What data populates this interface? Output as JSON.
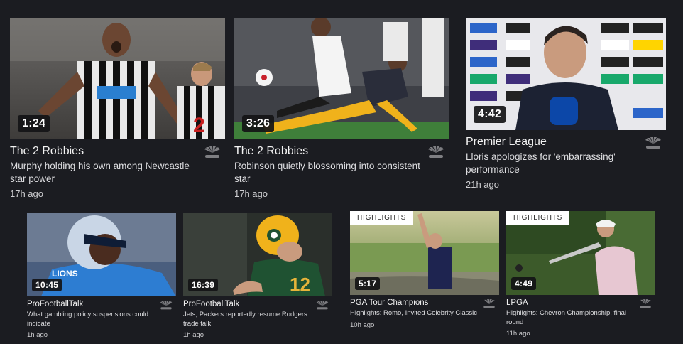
{
  "top_row": [
    {
      "duration": "1:24",
      "source": "The 2 Robbies",
      "title": "Murphy holding his own among Newcastle star power",
      "time": "17h ago"
    },
    {
      "duration": "3:26",
      "source": "The 2 Robbies",
      "title": "Robinson quietly blossoming into consistent star",
      "time": "17h ago"
    },
    {
      "duration": "4:42",
      "source": "Premier League",
      "title": "Lloris apologizes for 'embarrassing' performance",
      "time": "21h ago"
    }
  ],
  "bottom_row": [
    {
      "duration": "10:45",
      "source": "ProFootballTalk",
      "title": "What gambling policy suspensions could indicate",
      "time": "1h ago"
    },
    {
      "duration": "16:39",
      "source": "ProFootballTalk",
      "title": "Jets, Packers reportedly resume Rodgers trade talk",
      "time": "1h ago"
    },
    {
      "badge": "HIGHLIGHTS",
      "duration": "5:17",
      "source": "PGA Tour Champions",
      "title": "Highlights: Romo, Invited Celebrity Classic",
      "time": "10h ago"
    },
    {
      "badge": "HIGHLIGHTS",
      "duration": "4:49",
      "source": "LPGA",
      "title": "Highlights: Chevron Championship, final round",
      "time": "11h ago"
    }
  ],
  "logo_icon": "nbc-sports-peacock-icon",
  "colors": {
    "background": "#1b1c21",
    "duration_badge": "#141416",
    "highlight_badge": "#ffffff"
  }
}
